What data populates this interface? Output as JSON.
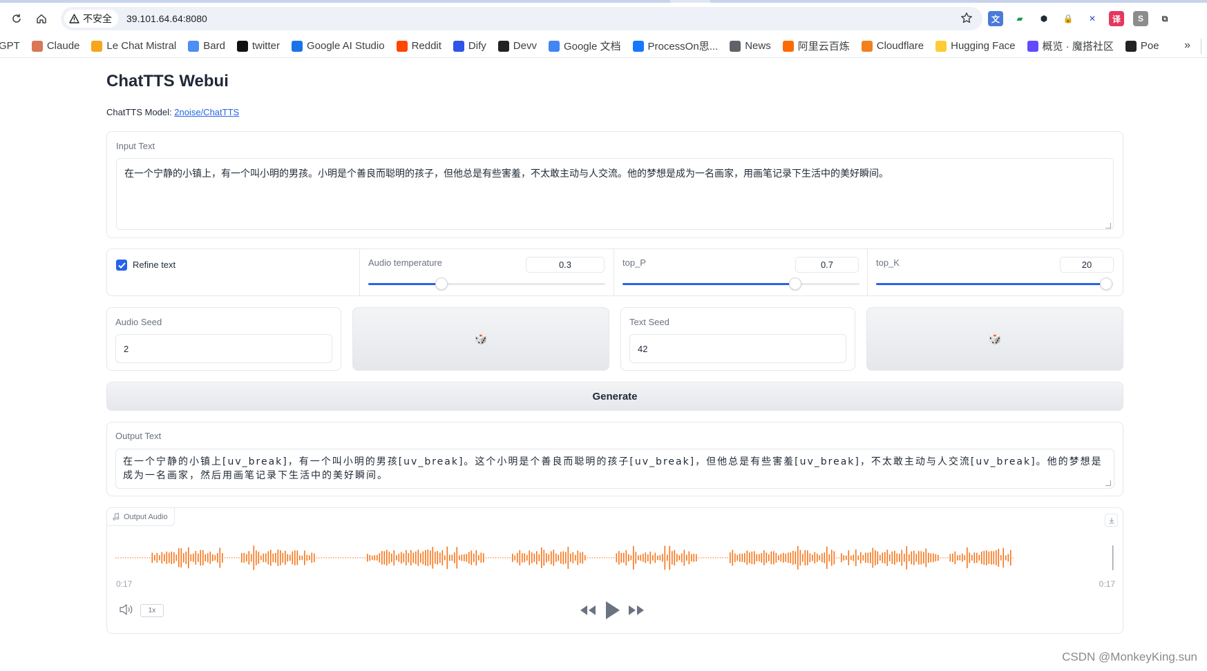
{
  "browser": {
    "security_label": "不安全",
    "url": "39.101.64.64:8080",
    "bookmarks": [
      {
        "label": "GPT",
        "icon": "gpt-icon",
        "color": "#ffffff"
      },
      {
        "label": "Claude",
        "icon": "claude-icon",
        "color": "#d97757"
      },
      {
        "label": "Le Chat Mistral",
        "icon": "mistral-icon",
        "color": "#f7a51c"
      },
      {
        "label": "Bard",
        "icon": "bard-icon",
        "color": "#4c8df6"
      },
      {
        "label": "twitter",
        "icon": "x-icon",
        "color": "#111111"
      },
      {
        "label": "Google AI Studio",
        "icon": "ai-studio-icon",
        "color": "#1a73e8"
      },
      {
        "label": "Reddit",
        "icon": "reddit-icon",
        "color": "#ff4500"
      },
      {
        "label": "Dify",
        "icon": "dify-icon",
        "color": "#2f54eb"
      },
      {
        "label": "Devv",
        "icon": "devv-icon",
        "color": "#222222"
      },
      {
        "label": "Google 文档",
        "icon": "google-docs-icon",
        "color": "#4285f4"
      },
      {
        "label": "ProcessOn思...",
        "icon": "processon-icon",
        "color": "#1677ff"
      },
      {
        "label": "News",
        "icon": "globe-icon",
        "color": "#5f6368"
      },
      {
        "label": "阿里云百炼",
        "icon": "aliyun-icon",
        "color": "#ff6a00"
      },
      {
        "label": "Cloudflare",
        "icon": "cloudflare-icon",
        "color": "#f38020"
      },
      {
        "label": "Hugging Face",
        "icon": "hugging-face-icon",
        "color": "#ffcc33"
      },
      {
        "label": "概览 · 魔搭社区",
        "icon": "modelscope-icon",
        "color": "#624aff"
      },
      {
        "label": "Poe",
        "icon": "poe-icon",
        "color": "#222222"
      }
    ],
    "more_label": "»"
  },
  "page": {
    "title": "ChatTTS Webui",
    "model_prefix": "ChatTTS Model: ",
    "model_link": "2noise/ChatTTS"
  },
  "input": {
    "label": "Input Text",
    "value": "在一个宁静的小镇上，有一个叫小明的男孩。小明是个善良而聪明的孩子，但他总是有些害羞，不太敢主动与人交流。他的梦想是成为一名画家，用画笔记录下生活中的美好瞬间。"
  },
  "controls": {
    "refine_label": "Refine text",
    "refine_checked": true,
    "audio_temperature": {
      "label": "Audio temperature",
      "value": "0.3",
      "fraction": 0.31
    },
    "top_p": {
      "label": "top_P",
      "value": "0.7",
      "fraction": 0.73
    },
    "top_k": {
      "label": "top_K",
      "value": "20",
      "fraction": 0.97
    }
  },
  "seeds": {
    "audio_label": "Audio Seed",
    "audio_value": "2",
    "text_label": "Text Seed",
    "text_value": "42",
    "dice_icon": "🎲"
  },
  "generate_label": "Generate",
  "output": {
    "label": "Output Text",
    "value": "在一个宁静的小镇上[uv_break]，有一个叫小明的男孩[uv_break]。这个小明是个善良而聪明的孩子[uv_break]，但他总是有些害羞[uv_break]，不太敢主动与人交流[uv_break]。他的梦想是成为一名画家，然后用画笔记录下生活中的美好瞬间。"
  },
  "audio": {
    "label": "Output Audio",
    "time_current": "0:17",
    "time_total": "0:17",
    "rate": "1x",
    "wave_color": "#f97316"
  },
  "watermark": "CSDN @MonkeyKing.sun"
}
